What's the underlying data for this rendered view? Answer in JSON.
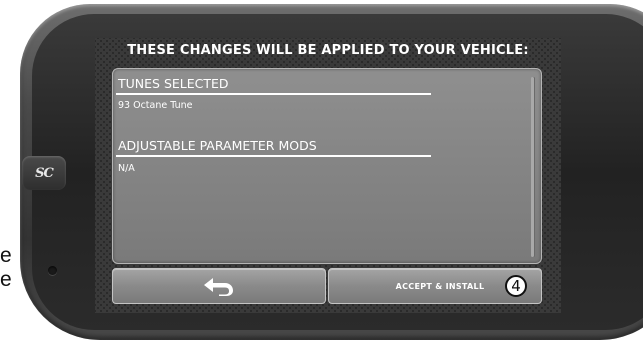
{
  "screen": {
    "title": "THESE CHANGES WILL BE APPLIED TO YOUR VEHICLE:"
  },
  "sections": [
    {
      "header": "TUNES SELECTED",
      "value": "93 Octane Tune"
    },
    {
      "header": "ADJUSTABLE PARAMETER MODS",
      "value": "N/A"
    }
  ],
  "buttons": {
    "back_icon": "back-arrow-icon",
    "accept_label": "ACCEPT & INSTALL"
  },
  "callout": {
    "step_number": "4"
  },
  "device": {
    "logo_text": "SC"
  },
  "page_edge_text": [
    "e",
    "e"
  ],
  "colors": {
    "bezel": "#3a3a3a",
    "screen_bg": "#1d1d1d",
    "panel_bg": "#858585",
    "text": "#ffffff"
  }
}
